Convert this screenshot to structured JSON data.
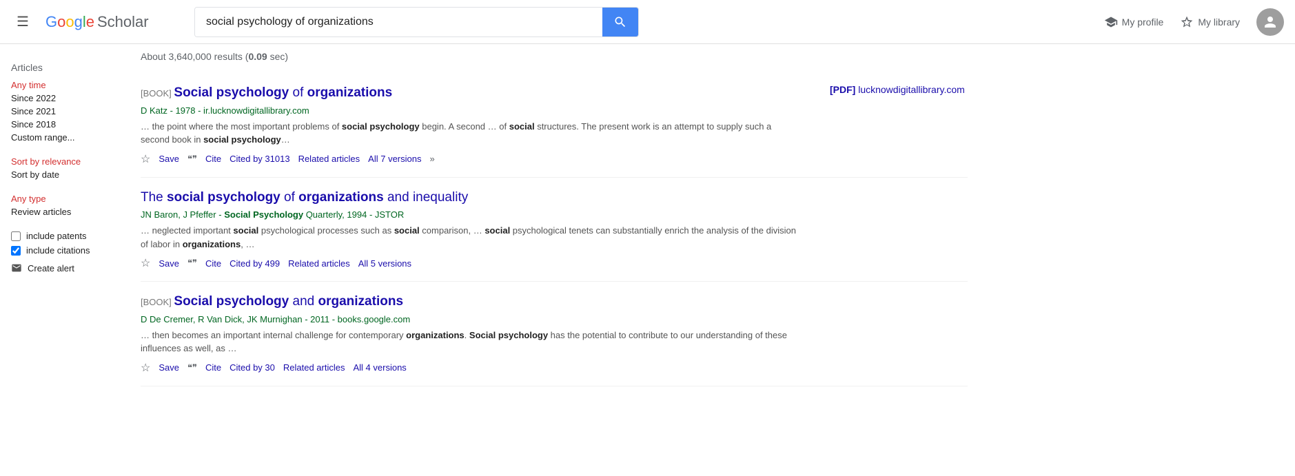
{
  "header": {
    "menu_label": "☰",
    "logo_google": "Google",
    "logo_scholar": "Scholar",
    "search_query": "social psychology of organizations",
    "search_placeholder": "social psychology of organizations",
    "search_icon": "🔍",
    "my_profile_label": "My profile",
    "my_library_label": "My library",
    "profile_icon": "person"
  },
  "sidebar": {
    "articles_label": "Articles",
    "time_filters": [
      {
        "label": "Any time",
        "active": true
      },
      {
        "label": "Since 2022",
        "active": false
      },
      {
        "label": "Since 2021",
        "active": false
      },
      {
        "label": "Since 2018",
        "active": false
      },
      {
        "label": "Custom range...",
        "active": false
      }
    ],
    "sort_filters": [
      {
        "label": "Sort by relevance",
        "active": true
      },
      {
        "label": "Sort by date",
        "active": false
      }
    ],
    "type_filters": [
      {
        "label": "Any type",
        "active": true
      },
      {
        "label": "Review articles",
        "active": false
      }
    ],
    "include_patents_label": "include patents",
    "include_citations_label": "include citations",
    "include_patents_checked": false,
    "include_citations_checked": true,
    "create_alert_label": "Create alert"
  },
  "results": {
    "summary": "About 3,640,000 results (0.09 sec)",
    "items": [
      {
        "id": 1,
        "tag": "[BOOK]",
        "title_parts": [
          {
            "text": "Social psychology",
            "bold": true
          },
          {
            "text": " of ",
            "bold": false
          },
          {
            "text": "organizations",
            "bold": true
          }
        ],
        "authors": "D Katz",
        "year": "1978",
        "source": "ir.lucknowdigitallibrary.com",
        "snippet": "… the point where the most important problems of <b>social psychology</b> begin. A second … of <b>social</b> structures. The present work is an attempt to supply such a second book in <b>social psychology</b>…",
        "save_label": "Save",
        "cite_label": "Cite",
        "cited_label": "Cited by 31013",
        "related_label": "Related articles",
        "versions_label": "All 7 versions",
        "pdf_host": "lucknowdigitallibrary.com",
        "pdf_label": "[PDF]"
      },
      {
        "id": 2,
        "tag": "",
        "title_parts": [
          {
            "text": "The ",
            "bold": false
          },
          {
            "text": "social psychology",
            "bold": true
          },
          {
            "text": " of ",
            "bold": false
          },
          {
            "text": "organizations",
            "bold": true
          },
          {
            "text": " and inequality",
            "bold": false
          }
        ],
        "authors": "JN Baron, J Pfeffer",
        "year_source": "Social Psychology Quarterly, 1994 - JSTOR",
        "snippet": "… neglected important <b>social</b> psychological processes such as <b>social</b> comparison, … <b>social</b> psychological tenets can substantially enrich the analysis of the division of labor in <b>organizations</b>, …",
        "save_label": "Save",
        "cite_label": "Cite",
        "cited_label": "Cited by 499",
        "related_label": "Related articles",
        "versions_label": "All 5 versions",
        "pdf_host": "",
        "pdf_label": ""
      },
      {
        "id": 3,
        "tag": "[BOOK]",
        "title_parts": [
          {
            "text": "Social psychology",
            "bold": true
          },
          {
            "text": " and ",
            "bold": false
          },
          {
            "text": "organizations",
            "bold": true
          }
        ],
        "authors": "D De Cremer, R Van Dick, JK Murnighan",
        "year": "2011",
        "source": "books.google.com",
        "snippet": "… then becomes an important internal challenge for contemporary <b>organizations</b>. <b>Social psychology</b> has the potential to contribute to our understanding of these influences as well, as …",
        "save_label": "Save",
        "cite_label": "Cite",
        "cited_label": "Cited by 30",
        "related_label": "Related articles",
        "versions_label": "All 4 versions",
        "pdf_host": "",
        "pdf_label": ""
      }
    ]
  }
}
